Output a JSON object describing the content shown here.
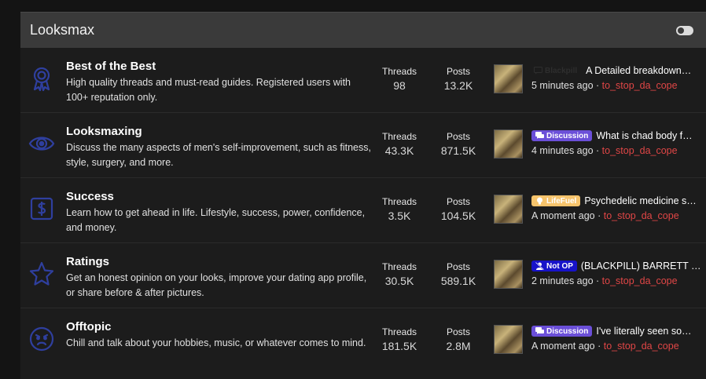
{
  "category": {
    "title": "Looksmax"
  },
  "colors": {
    "accent_icon": "#2f3f9e",
    "username": "#e04646",
    "discussion": "#6b4fd8",
    "lifefuel": "#f7c46c",
    "notop": "#1713c9"
  },
  "forums": [
    {
      "icon": "award-ribbon-icon",
      "title": "Best of the Best",
      "description": "High quality threads and must-read guides. Registered users with 100+ reputation only.",
      "threads_label": "Threads",
      "threads": "98",
      "posts_label": "Posts",
      "posts": "13.2K",
      "last": {
        "prefix": "Blackpill",
        "prefix_icon": "chat-icon",
        "title": "A Detailed breakdown…",
        "time": "5 minutes ago",
        "sep": "·",
        "user": "to_stop_da_cope"
      }
    },
    {
      "icon": "eye-icon",
      "title": "Looksmaxing",
      "description": "Discuss the many aspects of men's self-improvement, such as fitness, style, surgery, and more.",
      "threads_label": "Threads",
      "threads": "43.3K",
      "posts_label": "Posts",
      "posts": "871.5K",
      "last": {
        "prefix": "Discussion",
        "prefix_icon": "chat-icon",
        "title": "What is chad body f…",
        "time": "4 minutes ago",
        "sep": "·",
        "user": "to_stop_da_cope"
      }
    },
    {
      "icon": "dollar-document-icon",
      "title": "Success",
      "description": "Learn how to get ahead in life. Lifestyle, success, power, confidence, and money.",
      "threads_label": "Threads",
      "threads": "3.5K",
      "posts_label": "Posts",
      "posts": "104.5K",
      "last": {
        "prefix": "LifeFuel",
        "prefix_icon": "lightbulb-icon",
        "title": "Psychedelic medicine s…",
        "time": "A moment ago",
        "sep": "·",
        "user": "to_stop_da_cope"
      }
    },
    {
      "icon": "star-icon",
      "title": "Ratings",
      "description": "Get an honest opinion on your looks, improve your dating app profile, or share before & after pictures.",
      "threads_label": "Threads",
      "threads": "30.5K",
      "posts_label": "Posts",
      "posts": "589.1K",
      "last": {
        "prefix": "Not OP",
        "prefix_icon": "user-slash-icon",
        "title": "(BLACKPILL) BARRETT …",
        "time": "2 minutes ago",
        "sep": "·",
        "user": "to_stop_da_cope"
      }
    },
    {
      "icon": "angry-face-icon",
      "title": "Offtopic",
      "description": "Chill and talk about your hobbies, music, or whatever comes to mind.",
      "threads_label": "Threads",
      "threads": "181.5K",
      "posts_label": "Posts",
      "posts": "2.8M",
      "last": {
        "prefix": "Discussion",
        "prefix_icon": "chat-icon",
        "title": "I've literally seen so…",
        "time": "A moment ago",
        "sep": "·",
        "user": "to_stop_da_cope"
      }
    }
  ]
}
